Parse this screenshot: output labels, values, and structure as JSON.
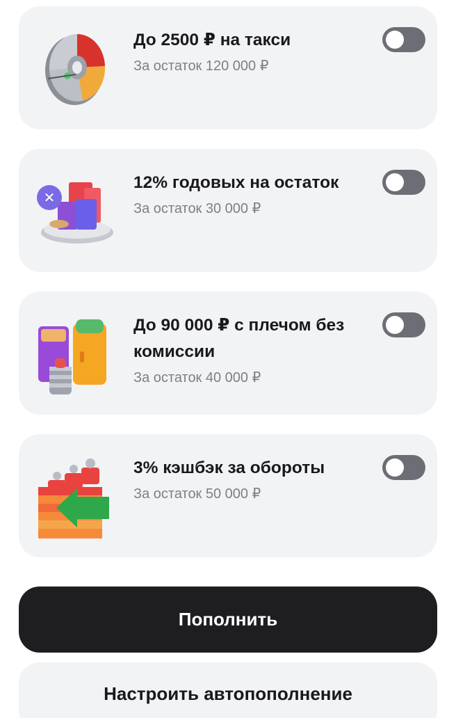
{
  "offers": [
    {
      "title": "До 2500 ₽ на такси",
      "subtitle": "За остаток 120 000 ₽",
      "icon": "pie-chart-icon",
      "enabled": false
    },
    {
      "title": "12% годовых на остаток",
      "subtitle": "За остаток 30 000 ₽",
      "icon": "bar-chart-percent-icon",
      "enabled": false
    },
    {
      "title": "До 90 000 ₽ с плечом без комиссии",
      "subtitle": "За остаток 40 000 ₽",
      "icon": "stocks-jars-icon",
      "enabled": false
    },
    {
      "title": "3% кэшбэк за обороты",
      "subtitle": "За остаток 50 000 ₽",
      "icon": "cashback-arrow-icon",
      "enabled": false
    }
  ],
  "actions": {
    "topup_label": "Пополнить",
    "autotopup_label": "Настроить автопополнение"
  },
  "colors": {
    "card_background": "#f2f3f5",
    "toggle_off": "#6c6e75",
    "primary_button": "#1e1e20",
    "subtitle_text": "#7d7f84"
  }
}
